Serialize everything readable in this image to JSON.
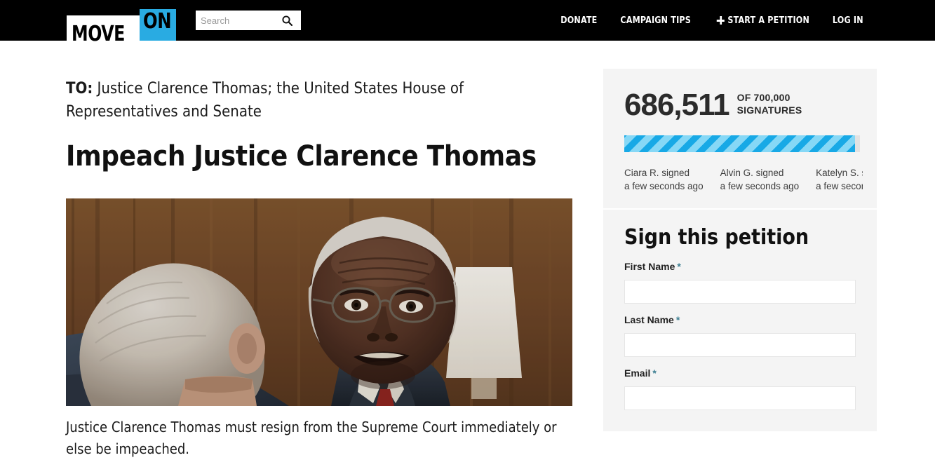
{
  "header": {
    "logo": {
      "part1": "MOVE",
      "part2": "ON"
    },
    "search": {
      "placeholder": "Search",
      "value": "",
      "icon": "search-icon"
    },
    "nav": [
      {
        "label": "DONATE",
        "icon": null
      },
      {
        "label": "CAMPAIGN TIPS",
        "icon": null
      },
      {
        "label": "START A PETITION",
        "icon": "plus-icon"
      },
      {
        "label": "LOG IN",
        "icon": null
      }
    ]
  },
  "petition": {
    "to_label": "TO:",
    "to_recipients": "Justice Clarence Thomas; the United States House of Representatives and Senate",
    "title": "Impeach Justice Clarence Thomas",
    "image_alt": "Justice Clarence Thomas speaking with another man in a wood-paneled room",
    "caption": "Justice Clarence Thomas must resign from the Supreme Court immediately or else be impeached."
  },
  "sidebar": {
    "counter": {
      "signatures": "686,511",
      "goal_line1": "OF 700,000",
      "goal_line2": "SIGNATURES",
      "progress_percent": 98
    },
    "signers": [
      {
        "name_action": "Ciara R. signed",
        "time": "a few seconds ago"
      },
      {
        "name_action": "Alvin G. signed",
        "time": "a few seconds ago"
      },
      {
        "name_action": "Katelyn S. signed",
        "time": "a few seconds ago"
      }
    ],
    "form": {
      "title": "Sign this petition",
      "required_marker": "*",
      "fields": [
        {
          "label": "First Name",
          "value": "",
          "placeholder": ""
        },
        {
          "label": "Last Name",
          "value": "",
          "placeholder": ""
        },
        {
          "label": "Email",
          "value": "",
          "placeholder": ""
        }
      ]
    }
  },
  "colors": {
    "header_bg": "#000000",
    "brand_blue": "#29abe2",
    "progress_dark": "#18a9e6",
    "progress_light": "#86d8f6",
    "sidebar_bg": "#f4f4f4",
    "required_star": "#3d7f92"
  }
}
